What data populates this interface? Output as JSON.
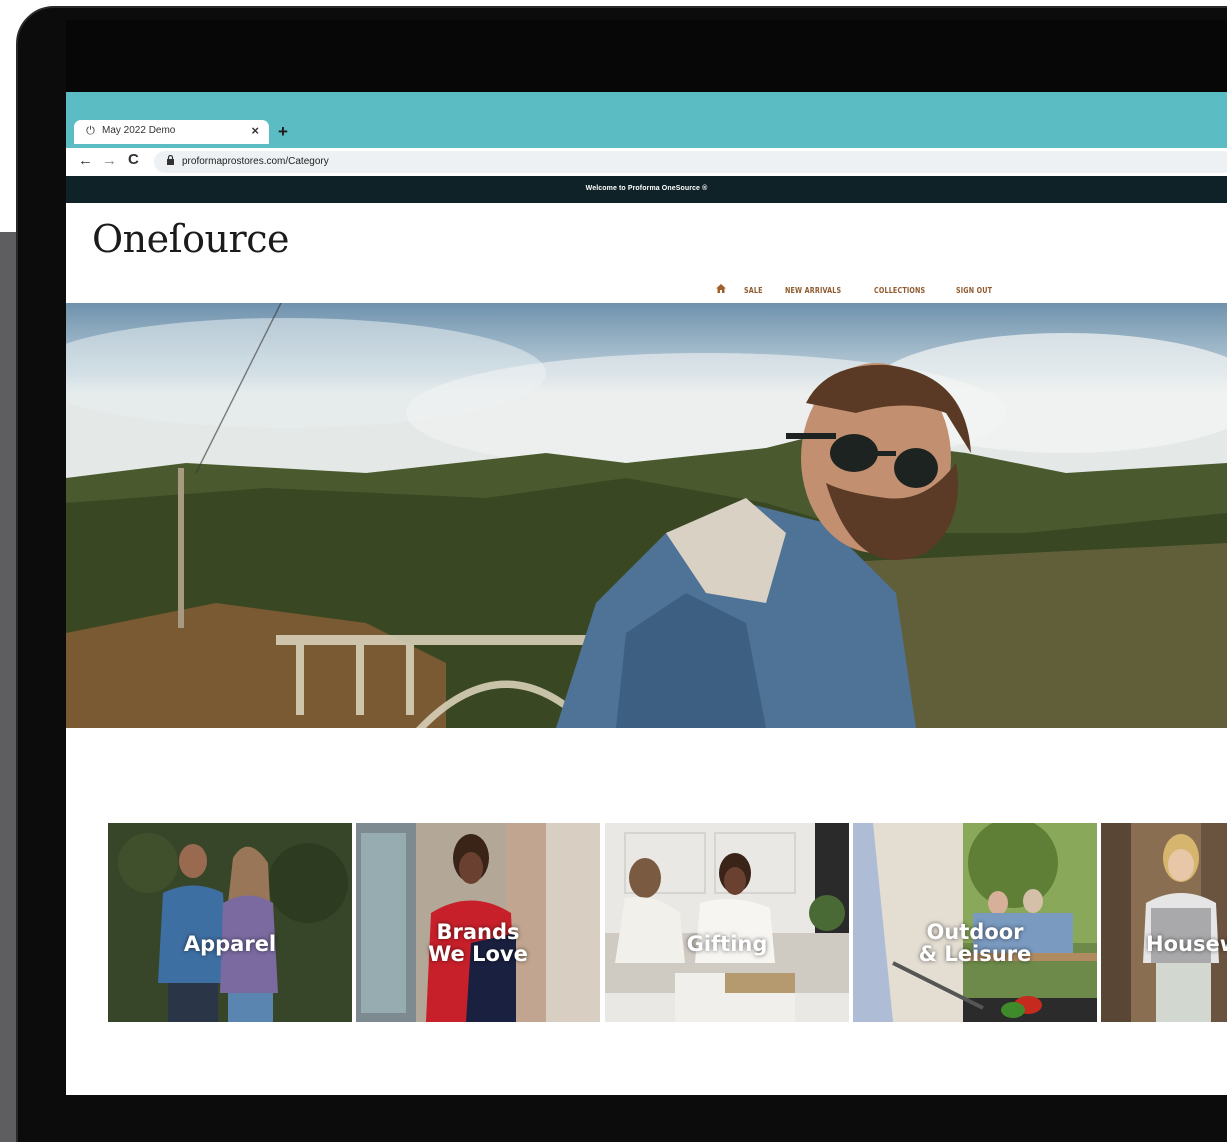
{
  "browser": {
    "tab_title": "May 2022 Demo",
    "tab_close": "×",
    "new_tab": "+",
    "back": "←",
    "forward": "→",
    "reload": "C",
    "lock": "🔒",
    "url": "proformaprostores.com/Category"
  },
  "site": {
    "welcome": "Welcome to Proforma OneSource ®",
    "logo": "Oneſource",
    "nav": {
      "home_icon": "⌂",
      "items": [
        "SALE",
        "NEW ARRIVALS",
        "COLLECTIONS",
        "SIGN OUT"
      ]
    }
  },
  "categories": [
    {
      "line1": "Apparel",
      "line2": ""
    },
    {
      "line1": "Brands",
      "line2": "We Love"
    },
    {
      "line1": "Gifting",
      "line2": ""
    },
    {
      "line1": "Outdoor",
      "line2": "& Leisure"
    },
    {
      "line1": "Housew",
      "line2": ""
    }
  ],
  "icons": {
    "tab_favicon": "power-icon",
    "home": "home-icon"
  }
}
